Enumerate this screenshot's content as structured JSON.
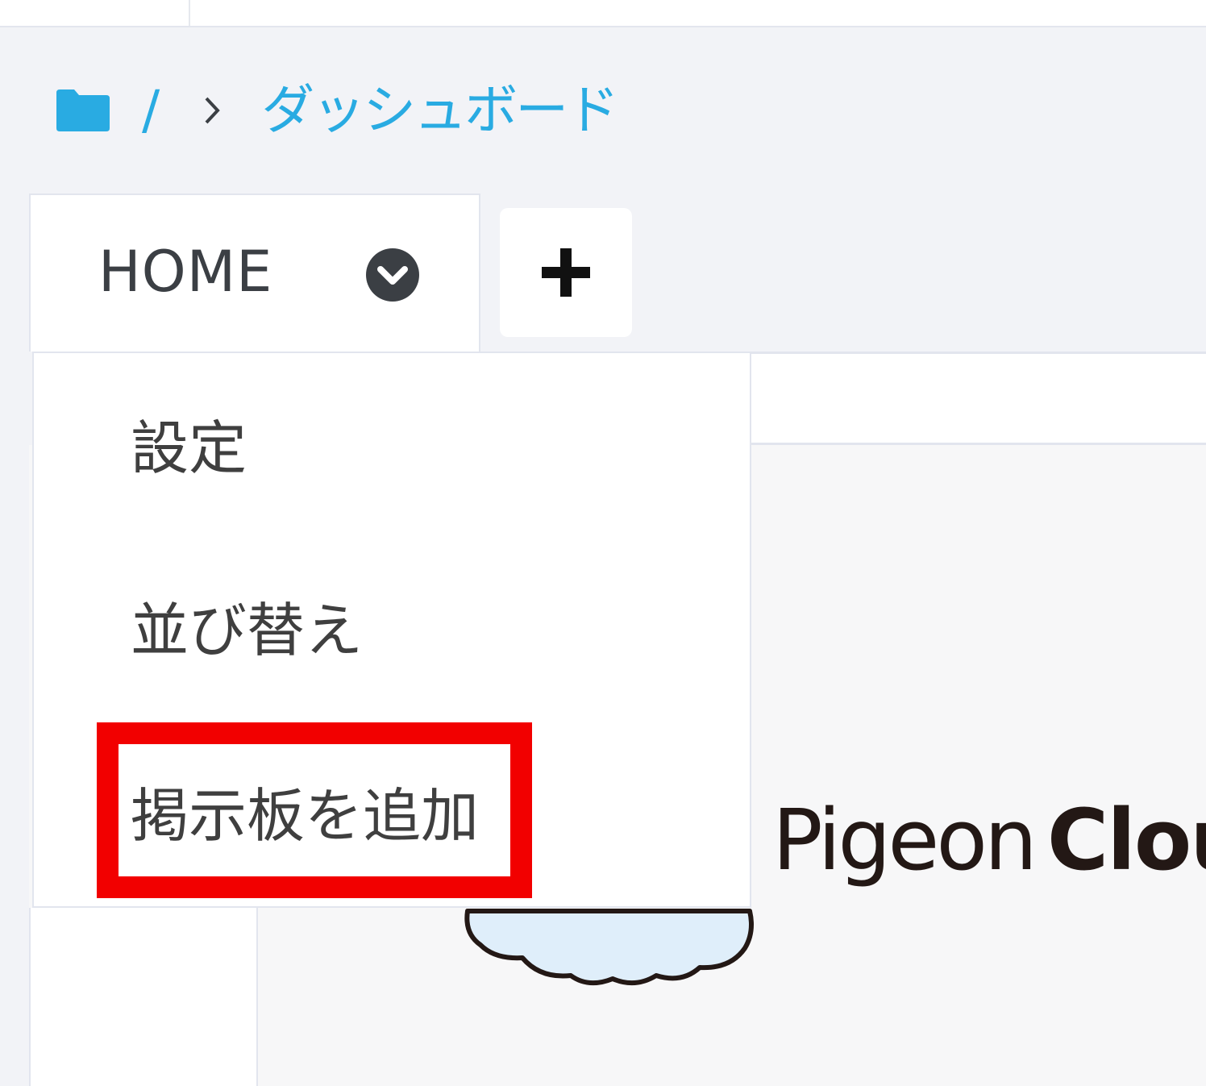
{
  "breadcrumb": {
    "root": "/",
    "current": "ダッシュボード"
  },
  "tabs": [
    {
      "label": "HOME"
    }
  ],
  "dropdown": {
    "items": [
      {
        "label": "設定"
      },
      {
        "label": "並び替え"
      },
      {
        "label": "掲示板を追加"
      }
    ],
    "highlighted_item": "掲示板を追加"
  },
  "logo": {
    "light": "Pigeon",
    "bold": "Clou"
  },
  "colors": {
    "accent": "#29abe2",
    "highlight": "#f20000",
    "text": "#3f3f3f",
    "background": "#f2f3f7"
  },
  "icons": {
    "folder": "folder-icon",
    "separator": "chevron-right-icon",
    "tab_menu": "chevron-down-circle-icon",
    "add_tab": "plus-icon"
  }
}
